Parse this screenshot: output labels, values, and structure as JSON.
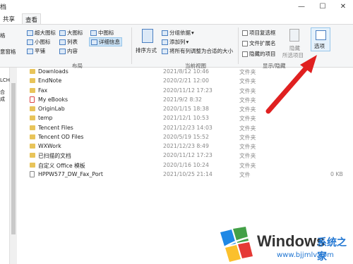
{
  "window": {
    "title": "档",
    "minimize": "—",
    "maximize": "☐",
    "close": "✕"
  },
  "tabs": [
    {
      "label": "共享"
    },
    {
      "label": "查看"
    }
  ],
  "ribbon": {
    "left_labels": [
      "格",
      "意窗格"
    ],
    "layout": {
      "items": [
        "超大图标",
        "大图标",
        "中图标",
        "小图标",
        "列表",
        "详细信息",
        "平铺",
        "内容"
      ],
      "group_label": "布局"
    },
    "current_view": {
      "sort_label": "排序方式",
      "group_by": "分组依据",
      "add_column": "添加列",
      "fit_columns": "将所有列调整为合适的大小",
      "group_label": "当前视图"
    },
    "show_hide": {
      "item_checkboxes": "项目复选框",
      "file_extensions": "文件扩展名",
      "hidden_items": "隐藏的项目",
      "hide_selected": [
        "隐藏",
        "所选项目"
      ],
      "group_label": "显示/隐藏"
    },
    "options_label": "选项"
  },
  "left_panel": [
    "LCH",
    "合成"
  ],
  "files": [
    {
      "name": "Downloads",
      "date": "2021/8/12 10:46",
      "type": "文件夹",
      "size": "",
      "icon": "folder"
    },
    {
      "name": "EndNote",
      "date": "2020/2/21 12:00",
      "type": "文件夹",
      "size": "",
      "icon": "folder"
    },
    {
      "name": "Fax",
      "date": "2020/11/12 17:23",
      "type": "文件夹",
      "size": "",
      "icon": "folder"
    },
    {
      "name": "My eBooks",
      "date": "2021/9/2 8:32",
      "type": "文件夹",
      "size": "",
      "icon": "folder-special"
    },
    {
      "name": "OriginLab",
      "date": "2020/1/15 18:38",
      "type": "文件夹",
      "size": "",
      "icon": "folder"
    },
    {
      "name": "temp",
      "date": "2021/12/1 10:53",
      "type": "文件夹",
      "size": "",
      "icon": "folder"
    },
    {
      "name": "Tencent Files",
      "date": "2021/12/23 14:03",
      "type": "文件夹",
      "size": "",
      "icon": "folder"
    },
    {
      "name": "Tencent OD Files",
      "date": "2020/5/19 15:52",
      "type": "文件夹",
      "size": "",
      "icon": "folder"
    },
    {
      "name": "WXWork",
      "date": "2021/12/23 8:49",
      "type": "文件夹",
      "size": "",
      "icon": "folder"
    },
    {
      "name": "已扫描的文档",
      "date": "2020/11/12 17:23",
      "type": "文件夹",
      "size": "",
      "icon": "folder"
    },
    {
      "name": "自定义 Office 模板",
      "date": "2020/1/16 10:24",
      "type": "文件夹",
      "size": "",
      "icon": "folder"
    },
    {
      "name": "HPPW577_DW_Fax_Port",
      "date": "2021/10/25 21:14",
      "type": "文件",
      "size": "0 KB",
      "icon": "file"
    }
  ],
  "watermark": {
    "brand": "Windows",
    "tagline": "系统之家",
    "url": "www.bjjmlv.com"
  },
  "colors": {
    "arrow": "#e02020",
    "folder": "#e8c45a",
    "selected": "#cde4f7",
    "ribbon_bg": "#f5f6f7",
    "accent": "#0078d7"
  }
}
